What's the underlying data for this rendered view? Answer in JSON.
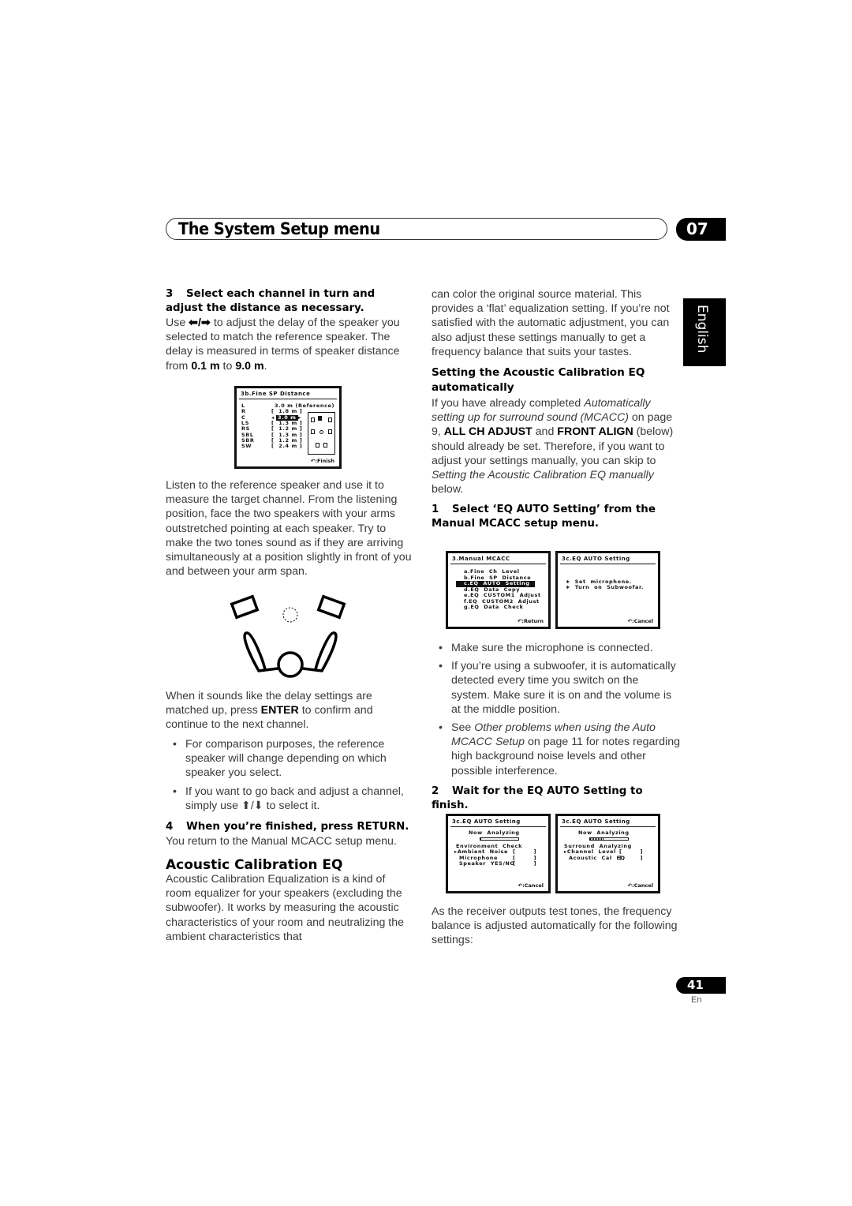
{
  "header": {
    "title": "The System Setup menu",
    "chapter": "07",
    "language_tab": "English"
  },
  "left": {
    "step3": {
      "num": "3",
      "text": "Select each channel in turn and adjust the distance as necessary."
    },
    "p1_a": "Use ",
    "p1_arrows": "⬅/➡",
    "p1_b": " to adjust the delay of the speaker you selected to match the reference speaker. The delay is measured in terms of speaker distance from ",
    "p1_min": "0.1 m",
    "p1_to": " to ",
    "p1_max": "9.0 m",
    "p1_end": ".",
    "osd_fine_sp": {
      "title": "3b.Fine  SP  Distance",
      "rows": [
        {
          "ch": "L",
          "val": "3.0 m (Reference)"
        },
        {
          "ch": "R",
          "val": "[  1.8 m ]"
        },
        {
          "ch": "C",
          "val": "3.0 m",
          "selected": true
        },
        {
          "ch": "LS",
          "val": "[  1.3 m ]"
        },
        {
          "ch": "RS",
          "val": "[  1.2 m ]"
        },
        {
          "ch": "SBL",
          "val": "[  1.3 m ]"
        },
        {
          "ch": "SBR",
          "val": "[  1.2 m ]"
        },
        {
          "ch": "SW",
          "val": "[  2.4 m ]"
        }
      ],
      "footer": ":Finish"
    },
    "p2": "Listen to the reference speaker and use it to measure the target channel. From the listening position, face the two speakers with your arms outstretched pointing at each speaker. Try to make the two tones sound as if they are arriving simultaneously at a position slightly in front of you and between your arm span.",
    "p3_a": "When it sounds like the delay settings are matched up, press ",
    "p3_key": "ENTER",
    "p3_b": " to confirm and continue to the next channel.",
    "bullets": [
      "For comparison purposes, the reference speaker will change depending on which speaker you select.",
      "If you want to go back and adjust a channel, simply use ⬆/⬇ to select it."
    ],
    "step4": {
      "num": "4",
      "text": "When you’re finished, press RETURN."
    },
    "p4": "You return to the Manual MCACC setup menu.",
    "section_title": "Acoustic Calibration EQ",
    "p5": "Acoustic Calibration Equalization is a kind of room equalizer for your speakers (excluding the subwoofer). It works by measuring the acoustic characteristics of your room and neutralizing the ambient characteristics that"
  },
  "right": {
    "p1": "can color the original source material. This provides a ‘flat’ equalization setting. If you’re not satisfied with the automatic adjustment, you can also adjust these settings manually to get a frequency balance that suits your tastes.",
    "subsection_title": "Setting the Acoustic Calibration EQ automatically",
    "p2_a": "If you have already completed ",
    "p2_ref1": "Automatically setting up for surround sound (MCACC)",
    "p2_b": " on page 9, ",
    "p2_k1": "ALL CH ADJUST",
    "p2_c": " and ",
    "p2_k2": "FRONT ALIGN",
    "p2_d": " (below) should already be set. Therefore, if you want to adjust your settings manually, you can skip to ",
    "p2_ref2": "Setting the Acoustic Calibration EQ manually",
    "p2_e": " below.",
    "step1": {
      "num": "1",
      "text": "Select ‘EQ AUTO Setting’ from the Manual MCACC setup menu."
    },
    "osd_manual_mcacc": {
      "title": "3.Manual  MCACC",
      "items": [
        "a.Fine  Ch  Level",
        "b.Fine  SP  Distance",
        "c.EQ  AUTO  Setting",
        "d.EQ  Data  Copy",
        "e.EQ  CUSTOM1  Adjust",
        "f.EQ  CUSTOM2  Adjust",
        "g.EQ  Data  Check"
      ],
      "selected_index": 2,
      "footer": ":Return"
    },
    "osd_eq_auto_1": {
      "title": "3c.EQ  AUTO  Setting",
      "lines": [
        "∗  Set  microphone.",
        "∗  Turn  on  Subwoofar."
      ],
      "footer": ":Cancel"
    },
    "bullets": [
      "Make sure the microphone is connected.",
      "If you’re using a subwoofer, it is automatically detected every time you switch on the system. Make sure it is on and the volume is at the middle position."
    ],
    "bullet3_a": "See ",
    "bullet3_ref": "Other problems when using the Auto MCACC Setup",
    "bullet3_b": " on page 11 for notes regarding high background noise levels and other possible interference.",
    "step2": {
      "num": "2",
      "text": "Wait for the EQ AUTO Setting to finish."
    },
    "osd_analyzing_1": {
      "title": "3c.EQ  AUTO  Setting",
      "status": "Now  Analyzing",
      "progress": 0.05,
      "heading": "Environment  Check",
      "rows": [
        "▸Ambient  Noise",
        "Microphone",
        "Speaker  YES/NO"
      ],
      "bracket": "[        ]",
      "footer": ":Cancel"
    },
    "osd_analyzing_2": {
      "title": "3c.EQ  AUTO  Setting",
      "status": "Now  Analyzing",
      "progress": 0.35,
      "heading": "Surround  Analyzing",
      "rows": [
        "▸Channel  Level",
        "Acoustic  Cal  EQ"
      ],
      "bracket": "[        ]",
      "footer": ":Cancel"
    },
    "p3": "As the receiver outputs test tones, the frequency balance is adjusted automatically for the following settings:"
  },
  "footer": {
    "page_number": "41",
    "lang_code": "En"
  }
}
